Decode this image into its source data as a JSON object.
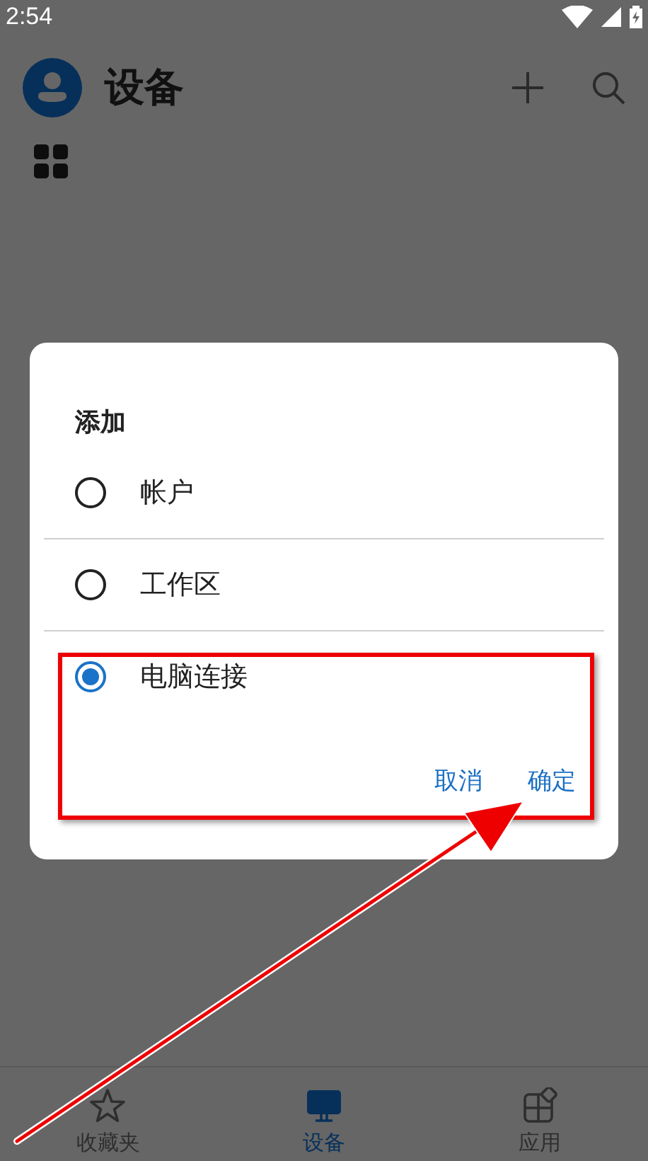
{
  "status_bar": {
    "time": "2:54"
  },
  "app_bar": {
    "title": "设备"
  },
  "bottom_nav": [
    {
      "label": "收藏夹",
      "selected": false
    },
    {
      "label": "设备",
      "selected": true
    },
    {
      "label": "应用",
      "selected": false
    }
  ],
  "dialog": {
    "title": "添加",
    "options": [
      {
        "label": "帐户",
        "selected": false
      },
      {
        "label": "工作区",
        "selected": false
      },
      {
        "label": "电脑连接",
        "selected": true
      }
    ],
    "buttons": [
      "取消",
      "确定"
    ]
  }
}
